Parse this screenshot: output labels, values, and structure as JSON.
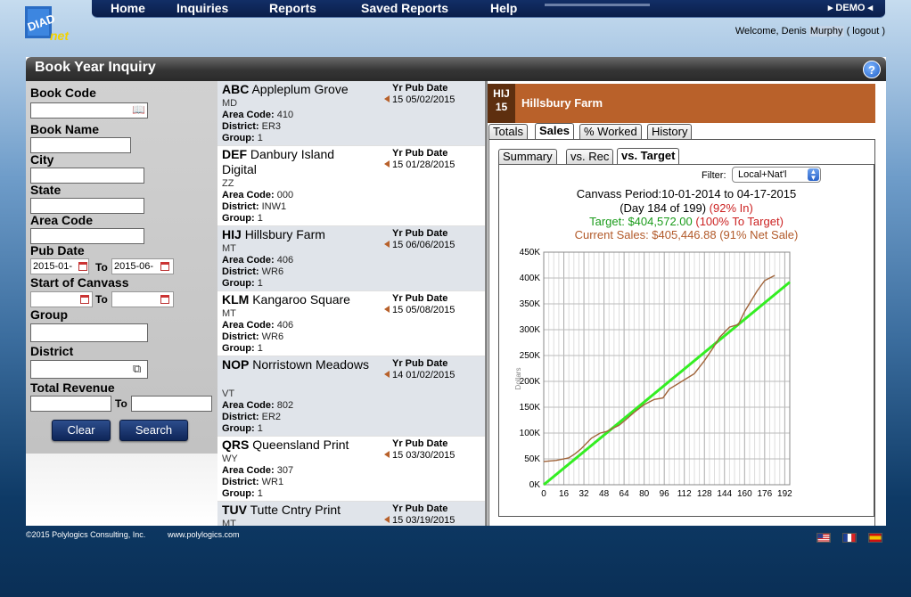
{
  "brand": {
    "logo_text_1": "DIAD",
    "logo_text_2": "net"
  },
  "nav": {
    "items": [
      "Home",
      "Inquiries",
      "Reports",
      "Saved Reports",
      "Help"
    ],
    "demo": "DEMO"
  },
  "welcome": {
    "prefix": "Welcome,",
    "first": "Denis",
    "last": "Murphy",
    "logout": "( logout )"
  },
  "page": {
    "title": "Book Year Inquiry",
    "help": "?"
  },
  "search": {
    "book_code": "Book Code",
    "book_name": "Book Name",
    "city": "City",
    "state": "State",
    "area_code": "Area Code",
    "pub_date": "Pub Date",
    "pub_from": "2015-01-",
    "pub_to": "2015-06-",
    "start_canvass": "Start of Canvass",
    "group": "Group",
    "district": "District",
    "total_revenue": "Total Revenue",
    "to": "To",
    "clear": "Clear",
    "search": "Search"
  },
  "result_labels": {
    "area": "Area Code:",
    "district": "District:",
    "group": "Group:",
    "yr_pub": "Yr Pub Date"
  },
  "results": [
    {
      "code": "ABC",
      "name": "Appleplum Grove",
      "state": "MD",
      "area": "410",
      "district": "ER3",
      "group": "1",
      "yr": "15 05/02/2015"
    },
    {
      "code": "DEF",
      "name": "Danbury Island Digital",
      "state": "ZZ",
      "area": "000",
      "district": "INW1",
      "group": "1",
      "yr": "15 01/28/2015"
    },
    {
      "code": "HIJ",
      "name": "Hillsbury Farm",
      "state": "MT",
      "area": "406",
      "district": "WR6",
      "group": "1",
      "yr": "15 06/06/2015"
    },
    {
      "code": "KLM",
      "name": "Kangaroo Square",
      "state": "MT",
      "area": "406",
      "district": "WR6",
      "group": "1",
      "yr": "15 05/08/2015"
    },
    {
      "code": "NOP",
      "name": "Norristown Meadows",
      "state": "VT",
      "area": "802",
      "district": "ER2",
      "group": "1",
      "yr": "14 01/02/2015"
    },
    {
      "code": "QRS",
      "name": "Queensland Print",
      "state": "WY",
      "area": "307",
      "district": "WR1",
      "group": "1",
      "yr": "15 03/30/2015"
    },
    {
      "code": "TUV",
      "name": "Tutte Cntry Print",
      "state": "MT",
      "area": "",
      "district": "",
      "group": "",
      "yr": "15 03/19/2015"
    }
  ],
  "detail": {
    "code": "HIJ",
    "year": "15",
    "name": "Hillsbury Farm",
    "tabs": [
      "Totals",
      "Sales",
      "% Worked",
      "History"
    ],
    "active_tab": "Sales",
    "subtabs": [
      "Summary",
      "vs. Rec",
      "vs. Target"
    ],
    "active_subtab": "vs. Target",
    "filter_label": "Filter:",
    "filter_value": "Local+Nat'l",
    "canvass": "Canvass Period:10-01-2014 to 04-17-2015",
    "day_text": "(Day 184 of 199)",
    "day_pct": "(92% In)",
    "target_text": "Target: $404,572.00",
    "target_pct": "(100% To Target)",
    "current_text": "Current Sales: $405,446.88 (91% Net Sale)"
  },
  "colors": {
    "target": "#1a9b1a",
    "current": "#b25a2a",
    "pct": "#cc2222",
    "header": "#b9612a",
    "target_line": "#33ee22",
    "sales_line": "#a0643a"
  },
  "chart_data": {
    "type": "line",
    "title": "",
    "xlabel": "",
    "ylabel": "Dollars",
    "xticks": [
      0,
      16,
      32,
      48,
      64,
      80,
      96,
      112,
      128,
      144,
      160,
      176,
      192
    ],
    "yticks": [
      "0K",
      "50K",
      "100K",
      "150K",
      "200K",
      "250K",
      "300K",
      "350K",
      "400K",
      "450K"
    ],
    "xlim": [
      0,
      196
    ],
    "ylim": [
      0,
      450000
    ],
    "grid": true,
    "series": [
      {
        "name": "",
        "x": [
          0,
          196
        ],
        "y": [
          0,
          392000
        ]
      },
      {
        "name": "",
        "x": [
          0,
          10,
          20,
          25,
          30,
          38,
          45,
          50,
          60,
          65,
          72,
          80,
          88,
          95,
          100,
          110,
          120,
          128,
          135,
          140,
          148,
          155,
          160,
          165,
          170,
          176,
          184
        ],
        "y": [
          45000,
          47000,
          52000,
          60000,
          70000,
          90000,
          100000,
          103000,
          115000,
          125000,
          140000,
          155000,
          165000,
          168000,
          185000,
          200000,
          215000,
          240000,
          265000,
          285000,
          305000,
          310000,
          335000,
          355000,
          375000,
          395000,
          405000
        ]
      }
    ]
  },
  "footer": {
    "copyright": "©2015 Polylogics Consulting, Inc.",
    "url": "www.polylogics.com"
  }
}
